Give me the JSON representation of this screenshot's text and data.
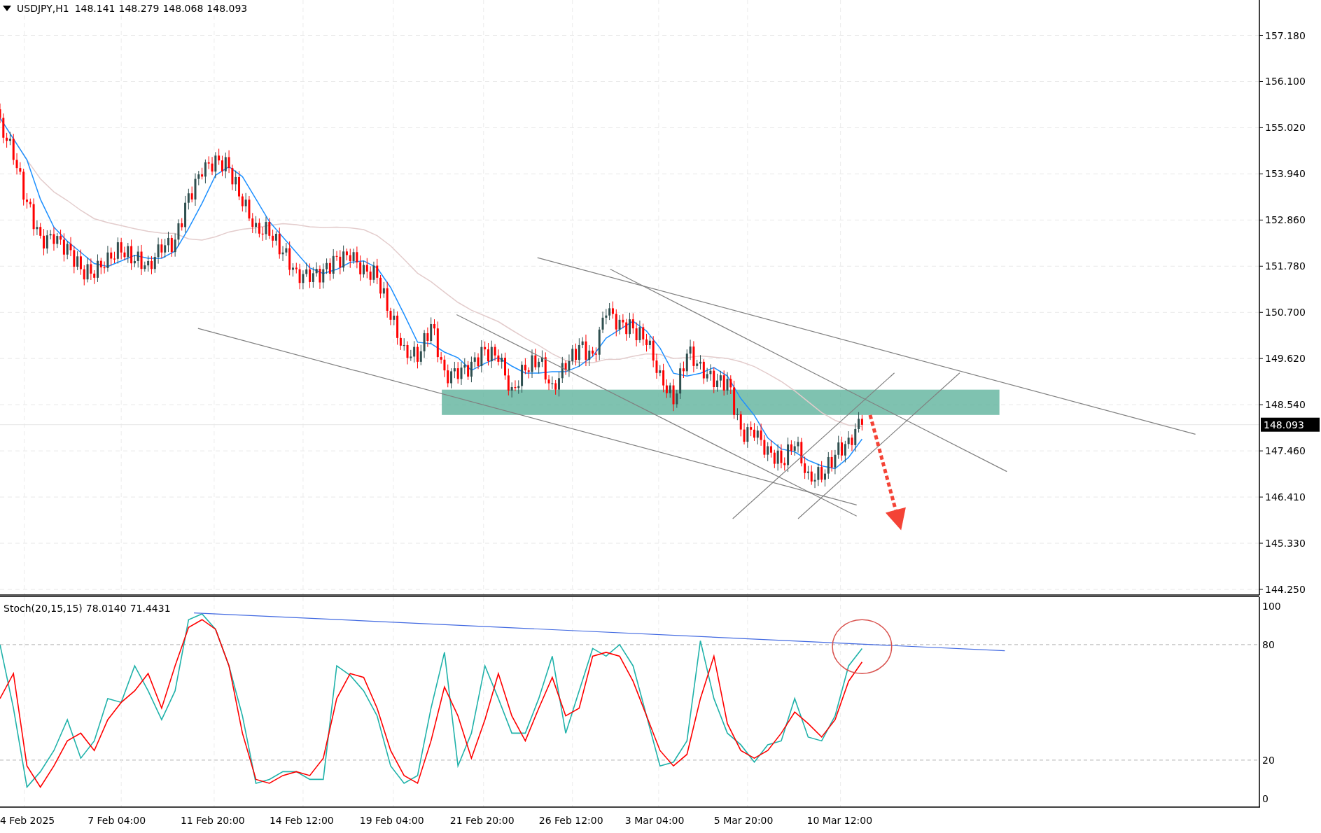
{
  "header": {
    "symbol": "USDJPY,H1",
    "ohlc": [
      "148.141",
      "148.279",
      "148.068",
      "148.093"
    ]
  },
  "price_axis": {
    "labels": [
      "157.180",
      "156.100",
      "155.020",
      "153.940",
      "152.860",
      "151.780",
      "150.700",
      "149.620",
      "148.540",
      "147.460",
      "146.410",
      "145.330",
      "144.250"
    ],
    "current_price": "148.093"
  },
  "stochastic": {
    "label": "Stoch(20,15,15)",
    "readings": [
      "78.0140",
      "71.4431"
    ],
    "axis_labels": [
      "100",
      "80",
      "20",
      "0"
    ]
  },
  "time_axis": [
    "4 Feb 2025",
    "7 Feb 04:00",
    "11 Feb 20:00",
    "14 Feb 12:00",
    "19 Feb 04:00",
    "21 Feb 20:00",
    "26 Feb 12:00",
    "3 Mar 04:00",
    "5 Mar 20:00",
    "10 Mar 12:00"
  ]
}
